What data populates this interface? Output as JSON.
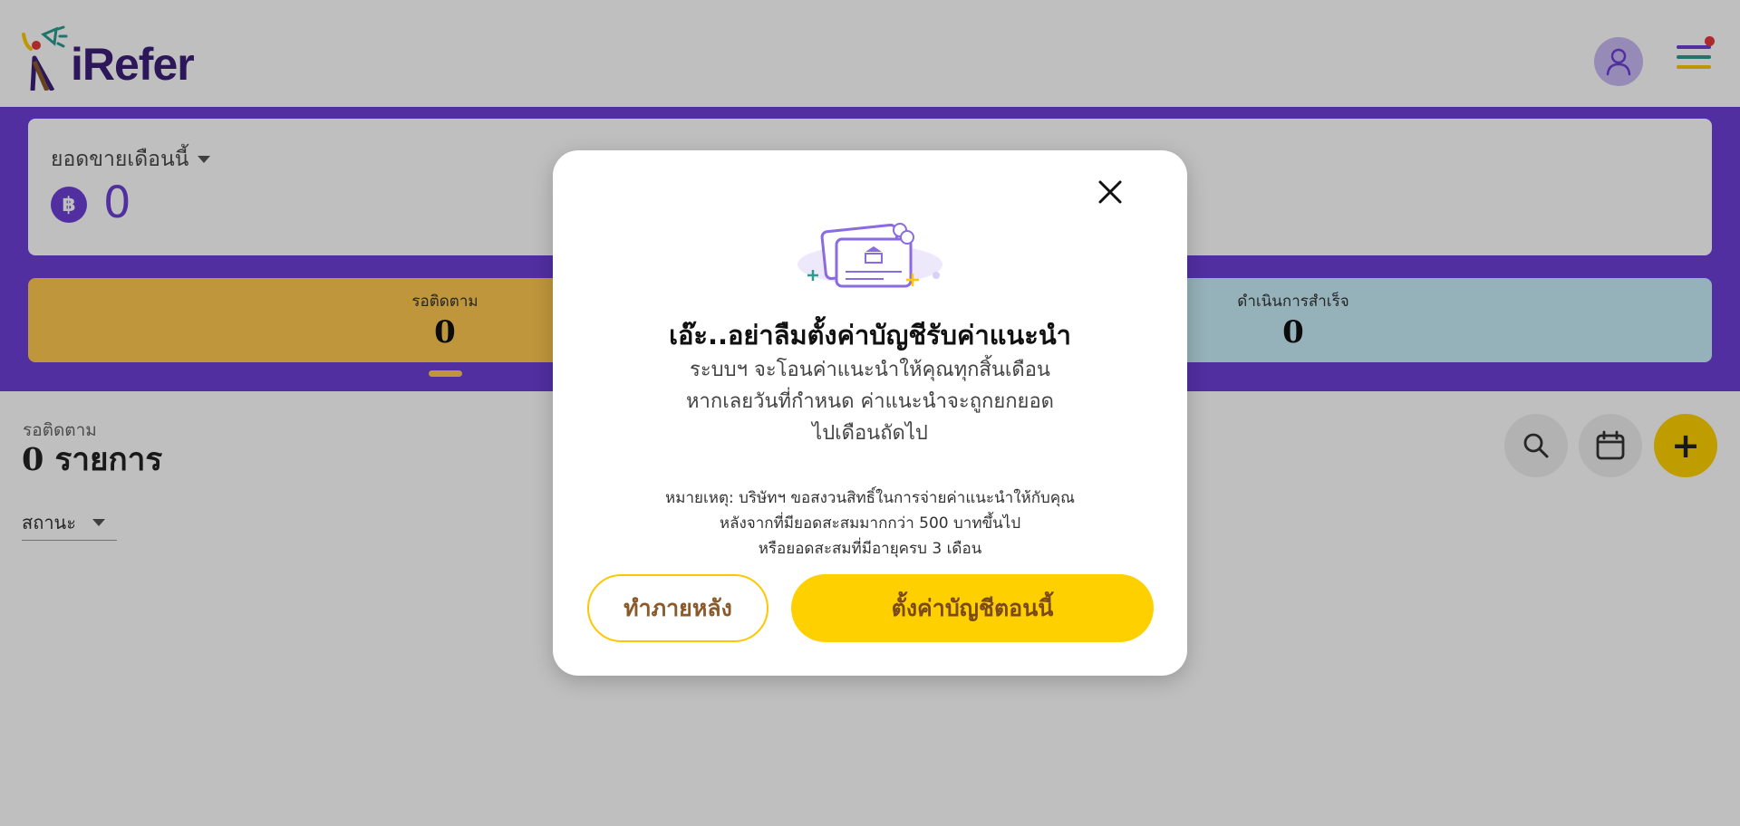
{
  "header": {
    "logo_text": "iRefer",
    "avatar_icon": "user-icon",
    "menu_icon": "hamburger-menu-icon",
    "menu_bar_colors": [
      "#6d3fd6",
      "#2a9d8f",
      "#ffc700"
    ],
    "notification_dot_color": "#e5383b"
  },
  "sales": {
    "label": "ยอดขายเดือนนี้",
    "currency_symbol": "฿",
    "value": "0"
  },
  "stats": [
    {
      "label": "รอติดตาม",
      "value": "0",
      "color": "#ffc850"
    },
    {
      "label": "ดำเนินการสำเร็จ",
      "value": "0",
      "color": "#c7ecf7"
    }
  ],
  "list": {
    "section_label": "รอติดตาม",
    "count_text": "0 รายการ",
    "status_filter": "สถานะ"
  },
  "actions": {
    "search_icon": "search-icon",
    "calendar_icon": "calendar-icon",
    "add_label": "+"
  },
  "modal": {
    "title": "เอ๊ะ..อย่าลืมตั้งค่าบัญชีรับค่าแนะนำ",
    "body_lines": [
      "ระบบฯ จะโอนค่าแนะนำให้คุณทุกสิ้นเดือน",
      "หากเลยวันที่กำหนด ค่าแนะนำจะถูกยกยอด",
      "ไปเดือนถัดไป"
    ],
    "note_lines": [
      "หมายเหตุ: บริษัทฯ ขอสงวนสิทธิ์ในการจ่ายค่าแนะนำให้กับคุณ",
      "หลังจากที่มียอดสะสมมากกว่า 500 บาทขึ้นไป",
      "หรือยอดสะสมที่มีอายุครบ 3 เดือน"
    ],
    "later_button": "ทำภายหลัง",
    "setup_button": "ตั้งค่าบัญชีตอนนี้",
    "illustration_icon": "bank-card-icon",
    "close_icon": "close-icon"
  },
  "colors": {
    "brand_purple": "#6d3fd6",
    "accent_yellow": "#ffd000",
    "overlay": "rgba(0,0,0,0.25)"
  }
}
